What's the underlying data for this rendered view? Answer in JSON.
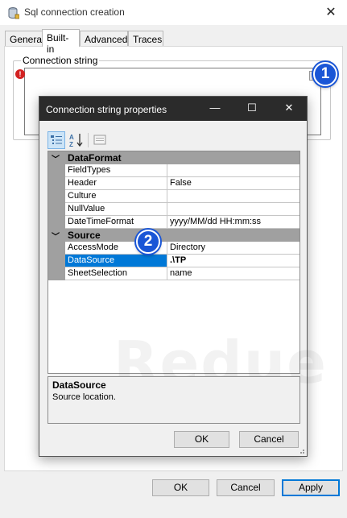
{
  "window": {
    "title": "Sql connection creation",
    "close_label": "✕"
  },
  "tabs": [
    {
      "label": "General"
    },
    {
      "label": "Built-in"
    },
    {
      "label": "Advanced"
    },
    {
      "label": "Traces"
    }
  ],
  "connection": {
    "group_label": "Connection string",
    "value": ""
  },
  "badges": {
    "one": "1",
    "two": "2"
  },
  "dialog": {
    "title": "Connection string properties",
    "minimize_label": "—",
    "maximize_label": "☐",
    "close_label": "✕"
  },
  "grid": {
    "categories": [
      {
        "name": "DataFormat",
        "properties": [
          {
            "name": "FieldTypes",
            "value": ""
          },
          {
            "name": "Header",
            "value": "False"
          },
          {
            "name": "Culture",
            "value": ""
          },
          {
            "name": "NullValue",
            "value": ""
          },
          {
            "name": "DateTimeFormat",
            "value": "yyyy/MM/dd HH:mm:ss"
          }
        ]
      },
      {
        "name": "Source",
        "properties": [
          {
            "name": "AccessMode",
            "value": "Directory"
          },
          {
            "name": "DataSource",
            "value": ".\\TP"
          },
          {
            "name": "SheetSelection",
            "value": "name"
          }
        ]
      }
    ]
  },
  "help": {
    "title": "DataSource",
    "description": "Source location."
  },
  "dialog_buttons": {
    "ok": "OK",
    "cancel": "Cancel"
  },
  "main_buttons": {
    "ok": "OK",
    "cancel": "Cancel",
    "apply": "Apply"
  },
  "watermark": "Redue",
  "colors": {
    "accent": "#0078d7",
    "badge": "#1a56d6",
    "dialog_title_bg": "#2b2b2b",
    "error": "#d32222",
    "category_bg": "#a0a0a0"
  }
}
